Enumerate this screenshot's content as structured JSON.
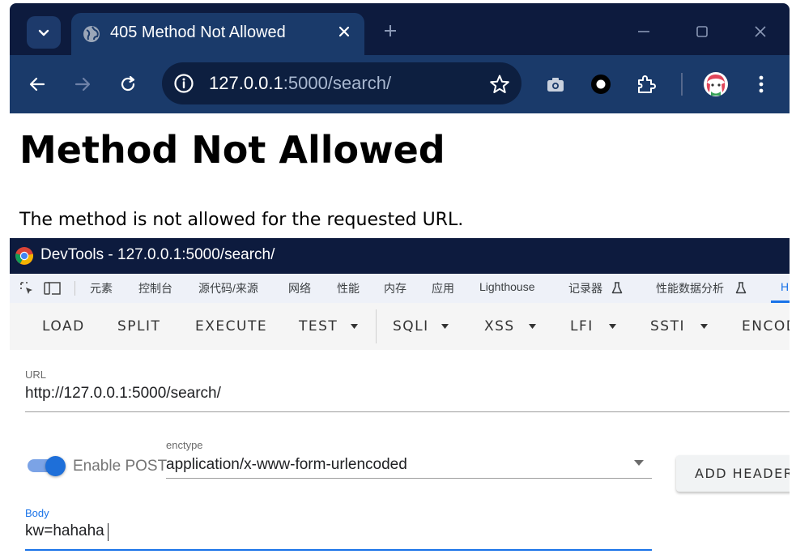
{
  "browser": {
    "tab_title": "405 Method Not Allowed",
    "url_host": "127.0.0.1",
    "url_path": ":5000/search/"
  },
  "page": {
    "heading": "Method Not Allowed",
    "message": "The method is not allowed for the requested URL."
  },
  "devtools": {
    "title": "DevTools - 127.0.0.1:5000/search/",
    "tabs": [
      "元素",
      "控制台",
      "源代码/来源",
      "网络",
      "性能",
      "内存",
      "应用",
      "Lighthouse",
      "记录器 ",
      "性能数据分析 ",
      "H"
    ]
  },
  "hackbar": {
    "buttons": [
      "LOAD",
      "SPLIT",
      "EXECUTE",
      "TEST",
      "SQLI",
      "XSS",
      "LFI",
      "SSTI",
      "ENCODING"
    ],
    "url_label": "URL",
    "url_value": "http://127.0.0.1:5000/search/",
    "enable_post_label": "Enable POST",
    "enable_post": true,
    "enctype_label": "enctype",
    "enctype_value": "application/x-www-form-urlencoded",
    "add_header_label": "ADD HEADER",
    "body_label": "Body",
    "body_value": "kw=hahaha"
  },
  "colors": {
    "chrome_dark": "#0d1b3e",
    "chrome_toolbar": "#1a3a6a",
    "accent": "#1a73e8"
  }
}
